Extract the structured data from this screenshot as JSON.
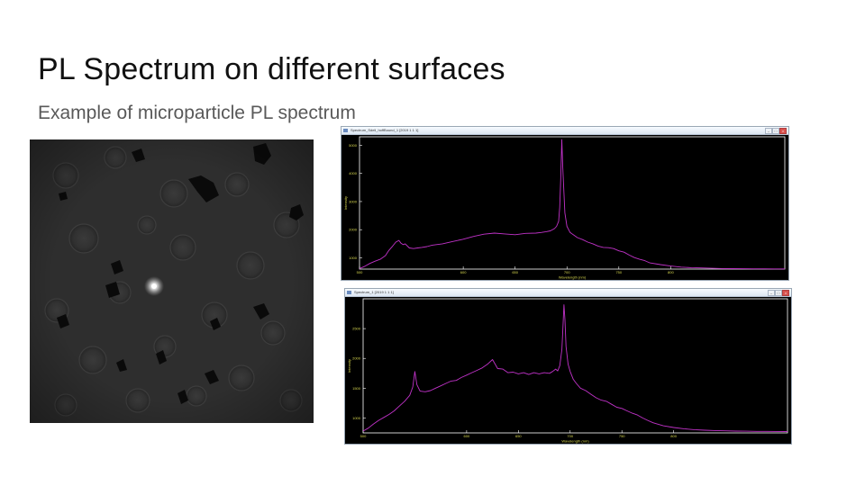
{
  "slide": {
    "title": "PL Spectrum on different surfaces",
    "subtitle": "Example of microparticle PL spectrum"
  },
  "colors": {
    "plot_background": "#000000",
    "spectrum_line": "#c032c8",
    "tick_label": "#d8d850",
    "frame": "#ffffff"
  },
  "windows": [
    {
      "title": "Spectrum_Sdeli_hoffBound_1 [2019 1 1 1]",
      "buttons": [
        "–",
        "□",
        "×"
      ]
    },
    {
      "title": "Spectrum_1 [2019 1 1 1]",
      "buttons": [
        "–",
        "□",
        "×"
      ]
    }
  ],
  "chart_data": [
    {
      "type": "line",
      "xlabel": "Wavelength (nm)",
      "ylabel": "Intensity",
      "xlim": [
        500,
        910
      ],
      "ylim": [
        600,
        5300
      ],
      "xticks": [
        500,
        600,
        650,
        700,
        750,
        800
      ],
      "xtick_labels": [
        "500",
        "600",
        "650",
        "700",
        "750",
        "800"
      ],
      "yticks": [
        1000,
        2000,
        3000,
        4000,
        5000
      ],
      "ytick_labels": [
        "1000",
        "2000",
        "3000",
        "4000",
        "5000"
      ],
      "grid": false,
      "series": [
        {
          "x": [
            500,
            505,
            510,
            515,
            520,
            525,
            528,
            532,
            535,
            538,
            540,
            542,
            544,
            548,
            552,
            556,
            560,
            565,
            570,
            580,
            590,
            600,
            610,
            620,
            630,
            640,
            650,
            660,
            670,
            675,
            680,
            684,
            688,
            690,
            692,
            693,
            694,
            695,
            696,
            698,
            700,
            703,
            706,
            710,
            715,
            720,
            725,
            730,
            735,
            740,
            745,
            750,
            755,
            760,
            765,
            770,
            775,
            780,
            790,
            800,
            810,
            820,
            830,
            840,
            850,
            860,
            870,
            880,
            890,
            900,
            910
          ],
          "y": [
            620,
            700,
            800,
            880,
            950,
            1080,
            1250,
            1420,
            1560,
            1620,
            1520,
            1470,
            1500,
            1350,
            1330,
            1350,
            1370,
            1400,
            1450,
            1500,
            1580,
            1660,
            1760,
            1840,
            1880,
            1850,
            1820,
            1870,
            1880,
            1900,
            1930,
            1960,
            2040,
            2120,
            2300,
            2800,
            3800,
            5200,
            4200,
            2600,
            2120,
            1900,
            1820,
            1720,
            1650,
            1560,
            1500,
            1420,
            1370,
            1360,
            1330,
            1250,
            1200,
            1100,
            1010,
            950,
            900,
            820,
            760,
            710,
            670,
            650,
            640,
            630,
            620,
            615,
            612,
            610,
            608,
            606,
            605
          ]
        }
      ]
    },
    {
      "type": "line",
      "xlabel": "Wavelength (nm)",
      "ylabel": "Intensity",
      "xlim": [
        500,
        910
      ],
      "ylim": [
        750,
        3000
      ],
      "xticks": [
        500,
        600,
        650,
        700,
        750,
        800
      ],
      "xtick_labels": [
        "500",
        "600",
        "650",
        "700",
        "750",
        "800"
      ],
      "yticks": [
        1000,
        1500,
        2000,
        2500
      ],
      "ytick_labels": [
        "1000",
        "1500",
        "2000",
        "2500"
      ],
      "grid": false,
      "series": [
        {
          "x": [
            500,
            505,
            510,
            515,
            520,
            525,
            530,
            535,
            540,
            545,
            548,
            550,
            552,
            555,
            560,
            565,
            570,
            575,
            580,
            585,
            590,
            595,
            600,
            605,
            610,
            615,
            620,
            625,
            630,
            635,
            640,
            645,
            650,
            655,
            660,
            665,
            670,
            675,
            680,
            683,
            686,
            688,
            690,
            692,
            693,
            694,
            695,
            696,
            698,
            700,
            703,
            706,
            710,
            715,
            720,
            725,
            730,
            735,
            740,
            745,
            750,
            755,
            760,
            765,
            770,
            775,
            780,
            790,
            800,
            810,
            820,
            830,
            840,
            850,
            860,
            870,
            880,
            890,
            900,
            910
          ],
          "y": [
            780,
            830,
            900,
            960,
            1010,
            1060,
            1120,
            1200,
            1280,
            1380,
            1520,
            1780,
            1560,
            1450,
            1440,
            1460,
            1500,
            1540,
            1580,
            1620,
            1630,
            1680,
            1720,
            1760,
            1800,
            1840,
            1900,
            1980,
            1830,
            1820,
            1760,
            1770,
            1740,
            1760,
            1730,
            1760,
            1740,
            1760,
            1750,
            1780,
            1820,
            1790,
            1880,
            2150,
            2500,
            2900,
            2650,
            2200,
            1900,
            1780,
            1650,
            1580,
            1500,
            1460,
            1400,
            1340,
            1300,
            1280,
            1230,
            1180,
            1160,
            1120,
            1080,
            1050,
            1000,
            960,
            920,
            870,
            840,
            820,
            805,
            795,
            790,
            785,
            780,
            778,
            776,
            775,
            774,
            773
          ]
        }
      ]
    }
  ]
}
